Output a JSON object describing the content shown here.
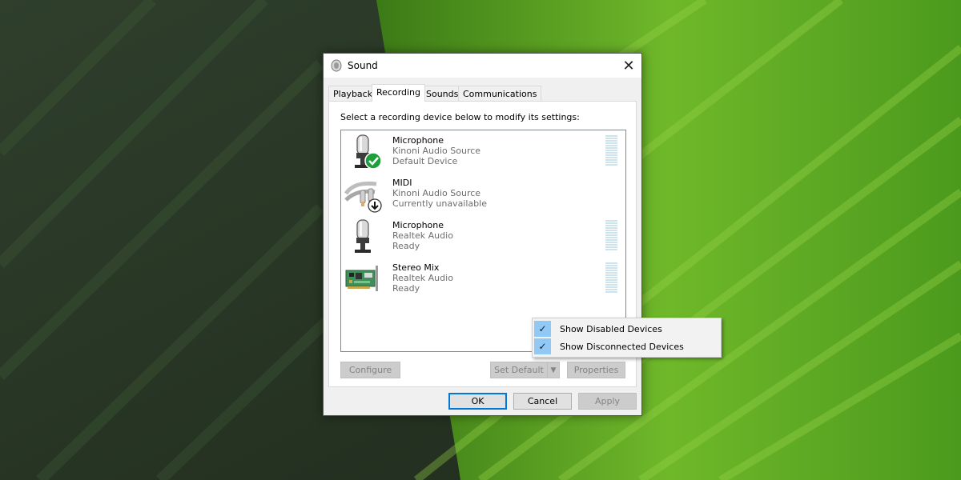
{
  "dialog": {
    "title": "Sound",
    "close_glyph": "✕",
    "tabs": [
      "Playback",
      "Recording",
      "Sounds",
      "Communications"
    ],
    "active_tab": "Recording",
    "instruction": "Select a recording device below to modify its settings:"
  },
  "devices": [
    {
      "name": "Microphone",
      "source": "Kinoni Audio Source",
      "status": "Default Device",
      "icon": "microphone-icon",
      "badge": "default-check-icon",
      "meter": true
    },
    {
      "name": "MIDI",
      "source": "Kinoni Audio Source",
      "status": "Currently unavailable",
      "icon": "midi-cable-icon",
      "badge": "unavailable-arrow-icon",
      "meter": false
    },
    {
      "name": "Microphone",
      "source": "Realtek Audio",
      "status": "Ready",
      "icon": "microphone-icon",
      "badge": "",
      "meter": true
    },
    {
      "name": "Stereo Mix",
      "source": "Realtek Audio",
      "status": "Ready",
      "icon": "sound-card-icon",
      "badge": "",
      "meter": true
    }
  ],
  "buttons": {
    "configure": "Configure",
    "set_default": "Set Default",
    "properties": "Properties",
    "ok": "OK",
    "cancel": "Cancel",
    "apply": "Apply"
  },
  "context_menu": {
    "items": [
      {
        "label": "Show Disabled Devices",
        "checked": true
      },
      {
        "label": "Show Disconnected Devices",
        "checked": true
      }
    ],
    "check_glyph": "✓"
  },
  "colors": {
    "accent": "#0078d7",
    "check_highlight": "#90c8f6",
    "default_badge": "#1e9e3c",
    "meter": "#cfe3ec"
  }
}
